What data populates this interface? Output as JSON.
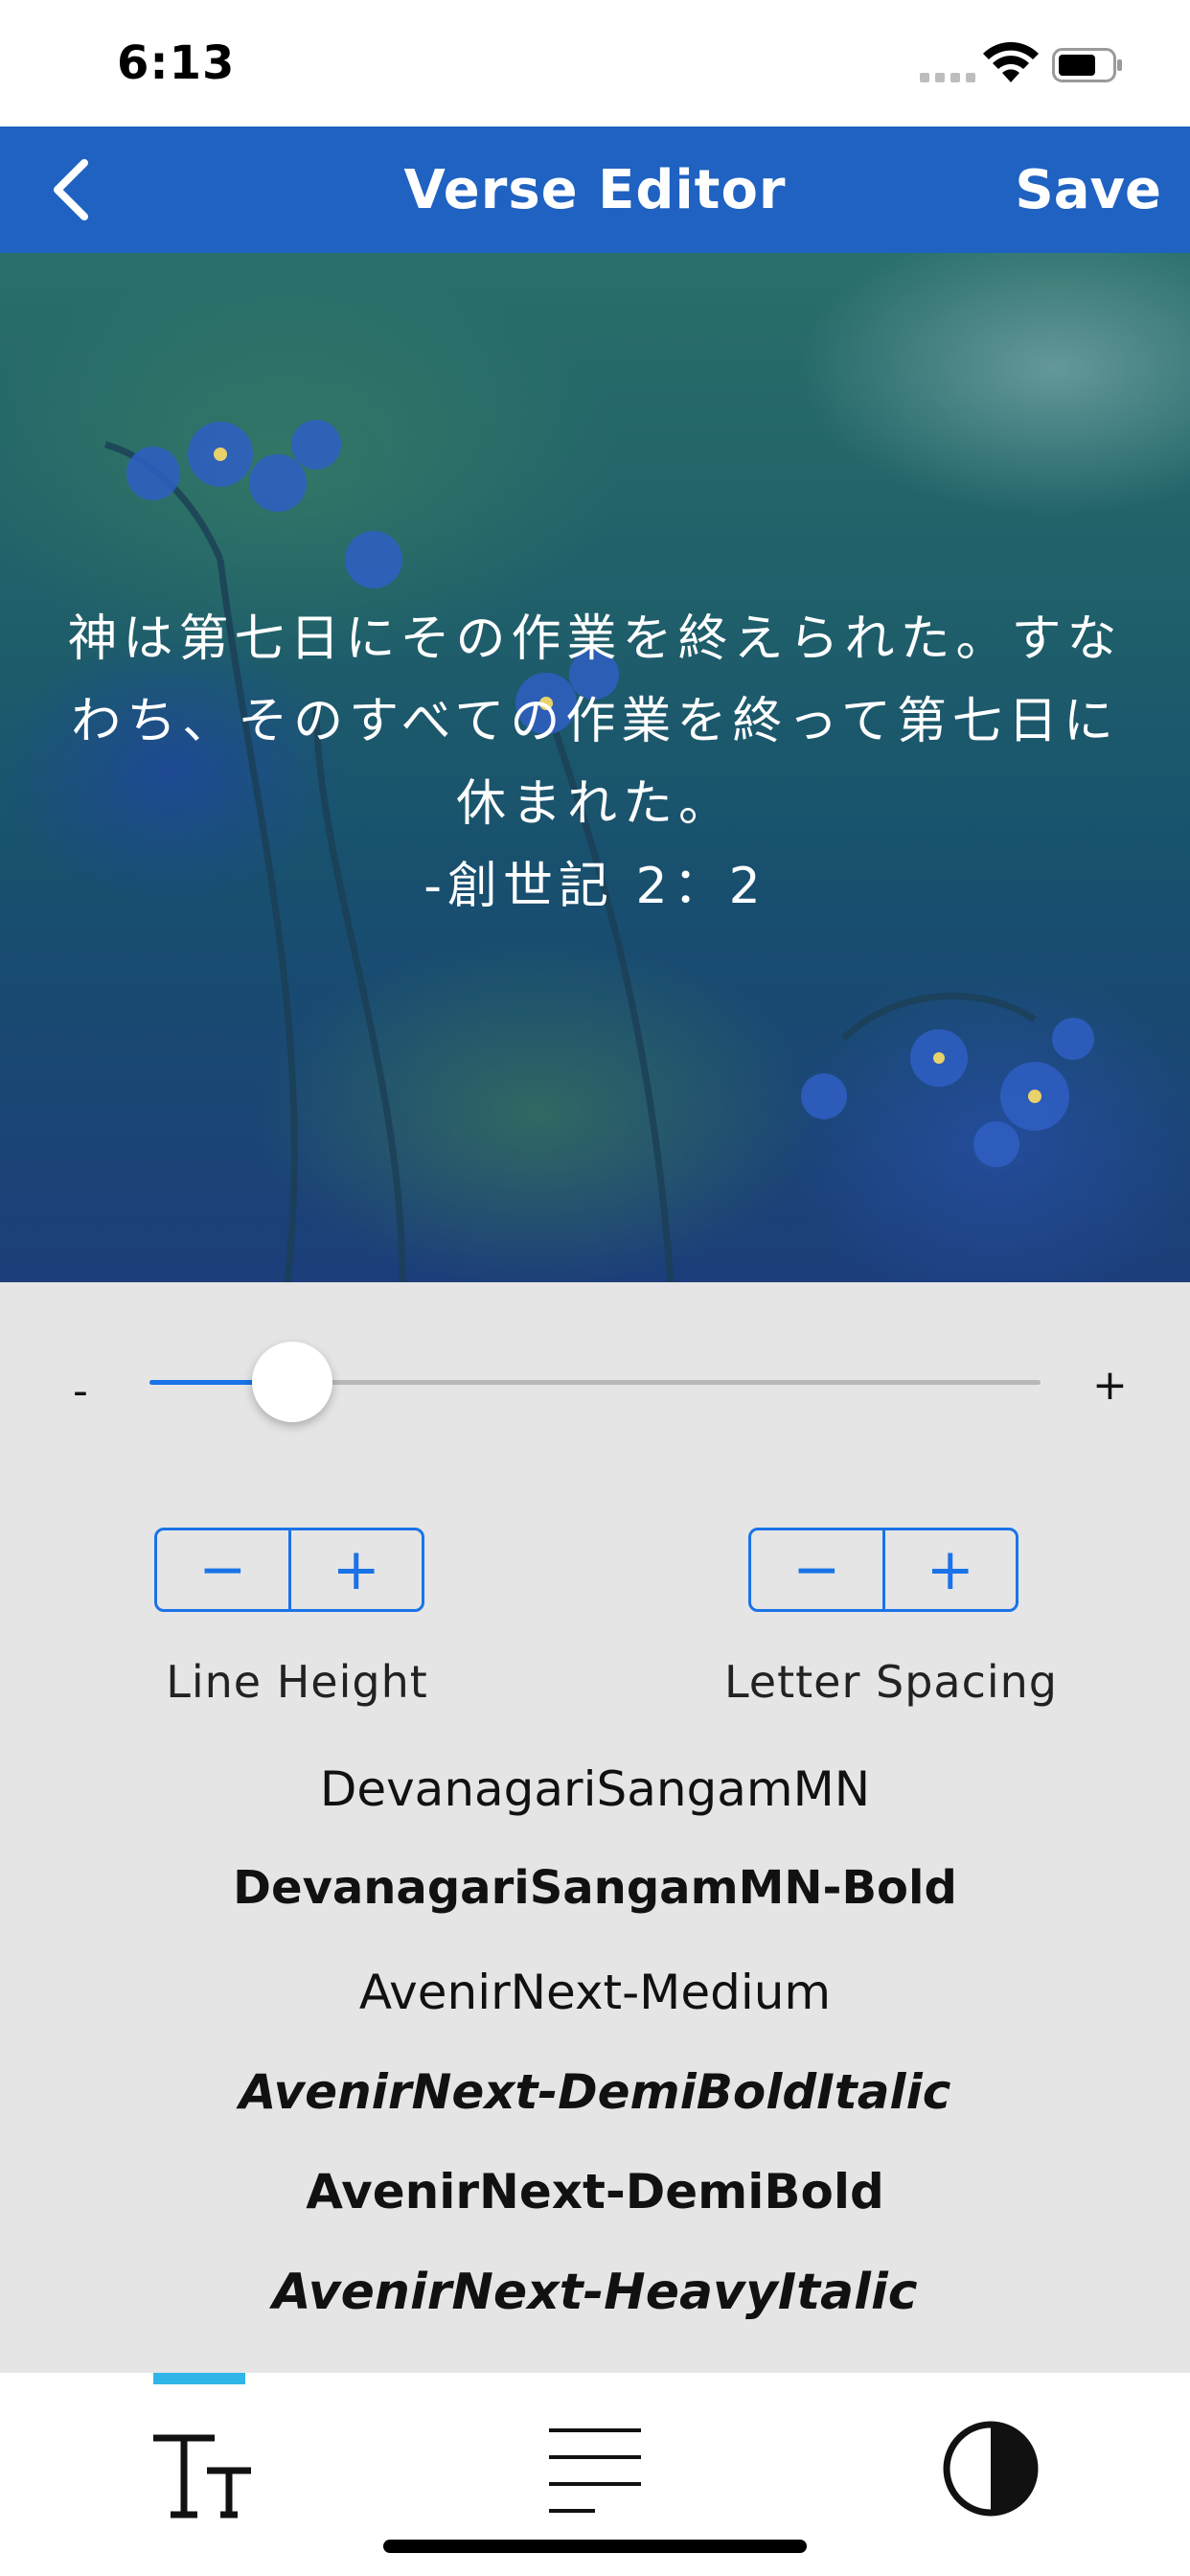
{
  "status_bar": {
    "time": "6:13",
    "icons": [
      "signal-icon",
      "wifi-icon",
      "battery-icon"
    ]
  },
  "nav": {
    "back_icon": "chevron-left-icon",
    "title": "Verse Editor",
    "save_label": "Save"
  },
  "verse": {
    "text": "神は第七日にその作業を終えられた。すなわち、そのすべての作業を終って第七日に休まれた。",
    "reference": "-創世記 2：2"
  },
  "font_size_slider": {
    "minus_label": "-",
    "plus_label": "+",
    "value_fraction": 0.16
  },
  "line_height": {
    "label": "Line Height",
    "decrease": "−",
    "increase": "+"
  },
  "letter_spacing": {
    "label": "Letter Spacing",
    "decrease": "−",
    "increase": "+"
  },
  "fonts": [
    "DevanagariSangamMN",
    "DevanagariSangamMN-Bold",
    "AvenirNext-Medium",
    "AvenirNext-DemiBoldItalic",
    "AvenirNext-DemiBold",
    "AvenirNext-HeavyItalic"
  ],
  "tabs": [
    {
      "icon": "text-size-icon",
      "selected": true
    },
    {
      "icon": "text-align-icon",
      "selected": false
    },
    {
      "icon": "contrast-icon",
      "selected": false
    }
  ],
  "colors": {
    "nav_background": "#1f62c1",
    "accent": "#1a73e8",
    "tab_indicator": "#2fb5e8",
    "panel_background": "#e5e5e5"
  }
}
